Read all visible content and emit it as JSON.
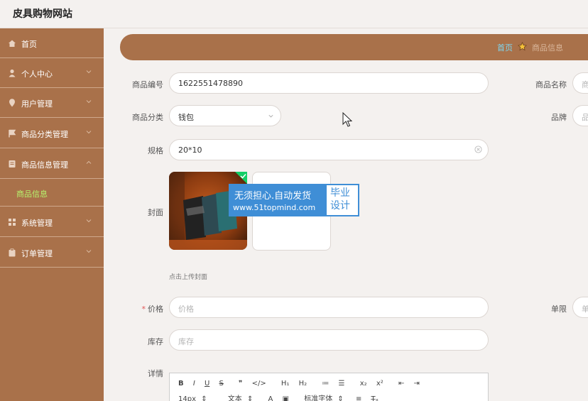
{
  "app": {
    "title": "皮具购物网站"
  },
  "sidebar": {
    "items": [
      {
        "label": "首页",
        "icon": "home-icon"
      },
      {
        "label": "个人中心",
        "icon": "user-icon"
      },
      {
        "label": "用户管理",
        "icon": "location-icon"
      },
      {
        "label": "商品分类管理",
        "icon": "flag-icon"
      },
      {
        "label": "商品信息管理",
        "icon": "document-icon"
      },
      {
        "label": "商品信息",
        "icon": ""
      },
      {
        "label": "系统管理",
        "icon": "grid-icon"
      },
      {
        "label": "订单管理",
        "icon": "clipboard-icon"
      }
    ],
    "active_sub": "商品信息"
  },
  "breadcrumb": {
    "home": "首页",
    "current": "商品信息"
  },
  "form": {
    "product_no": {
      "label": "商品编号",
      "value": "1622551478890"
    },
    "product_name": {
      "label": "商品名称",
      "placeholder": "商"
    },
    "category": {
      "label": "商品分类",
      "value": "钱包"
    },
    "brand": {
      "label": "品牌",
      "placeholder": "品"
    },
    "spec": {
      "label": "规格",
      "value": "20*10"
    },
    "cover": {
      "label": "封面",
      "hint": "点击上传封面"
    },
    "price": {
      "label": "价格",
      "placeholder": "价格",
      "required_mark": "*"
    },
    "limit": {
      "label": "单限",
      "placeholder": "单"
    },
    "stock": {
      "label": "库存",
      "placeholder": "库存"
    },
    "detail": {
      "label": "详情"
    }
  },
  "watermark": {
    "line1": "无须担心.自动发货",
    "line2": "www.51topmind.com",
    "side": [
      "毕业",
      "设计"
    ]
  },
  "editor": {
    "row1": [
      "B",
      "I",
      "U",
      "S",
      "❞",
      "</>",
      "H₁",
      "H₂",
      "≔",
      "☰",
      "x₂",
      "x²",
      "⇤",
      "⇥"
    ],
    "font_size": "14px",
    "block_type": "文本",
    "font_family": "标准字体"
  },
  "colors": {
    "accent": "#a9714a",
    "breadcrumb_home": "#7ed6f0",
    "active_sub": "#b6f36d"
  }
}
